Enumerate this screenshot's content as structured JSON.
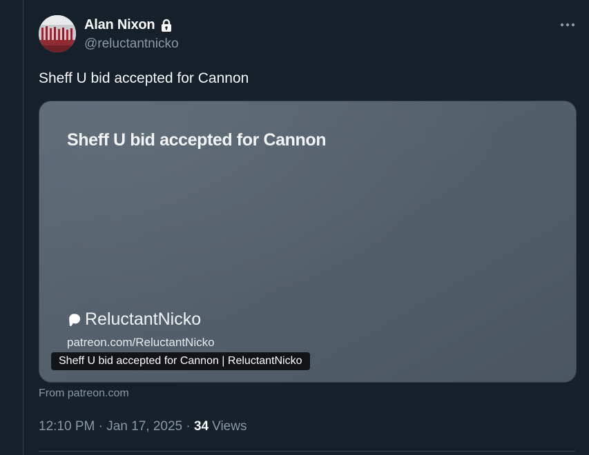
{
  "author": {
    "name": "Alan Nixon",
    "handle": "@reluctantnicko",
    "avatar_icon": "avatar-photo",
    "protected_icon": "lock-icon"
  },
  "more_icon": "more-dots-icon",
  "tweet": {
    "text": "Sheff U bid accepted for Cannon"
  },
  "card": {
    "title": "Sheff U bid accepted for Cannon",
    "brand_icon": "patreon-icon",
    "brand": "ReluctantNicko",
    "url": "patreon.com/ReluctantNicko",
    "caption": "Sheff U bid accepted for Cannon | ReluctantNicko"
  },
  "source_note": "From patreon.com",
  "meta": {
    "time": "12:10 PM",
    "separator": " · ",
    "date": "Jan 17, 2025",
    "views_count": "34",
    "views_label": "Views"
  },
  "colors": {
    "background": "#15202b",
    "text_primary": "#f7f9f9",
    "text_secondary": "#8b98a5",
    "border": "#38444d"
  }
}
